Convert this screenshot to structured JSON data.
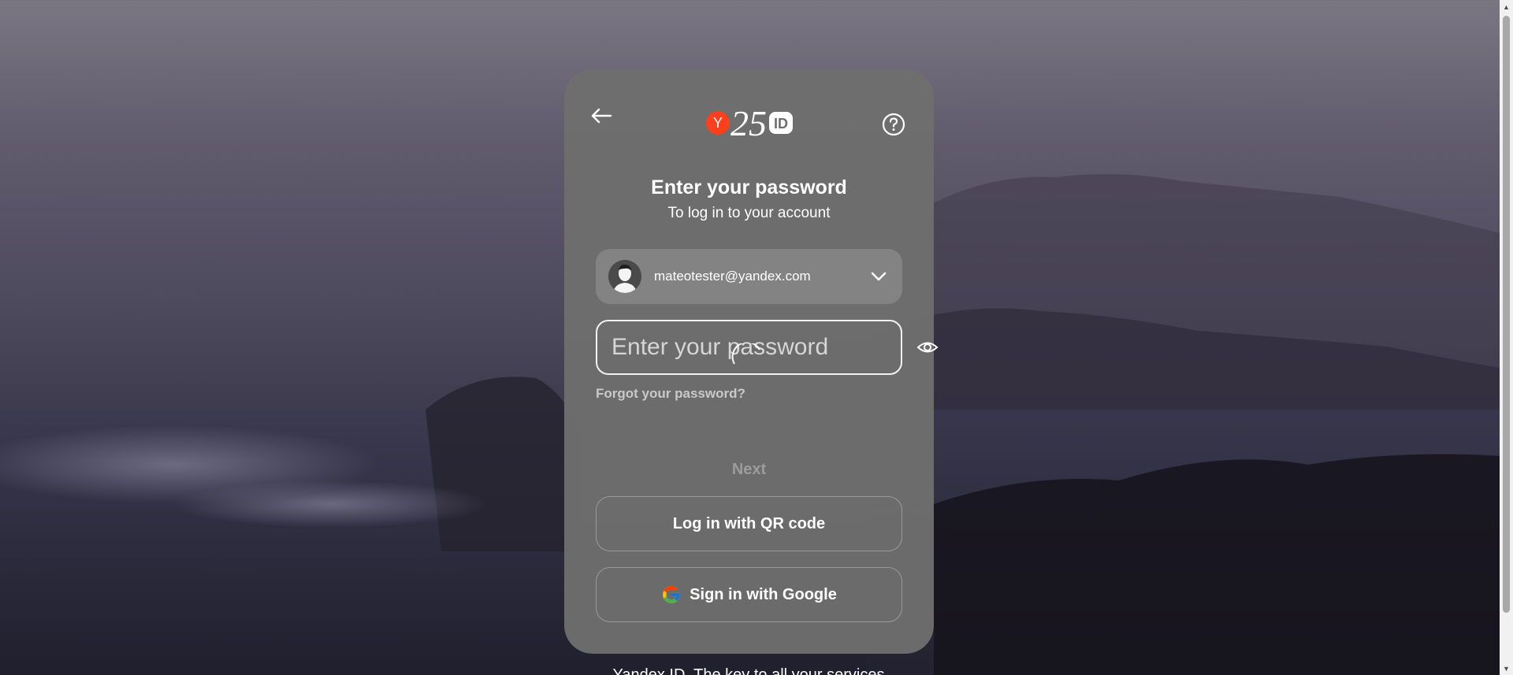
{
  "page": {
    "title": "Enter your password",
    "subtitle": "To log in to your account"
  },
  "header": {
    "logo_text": "25",
    "logo_letter": "Y",
    "logo_id": "ID"
  },
  "account": {
    "email": "mateotester@yandex.com"
  },
  "password_field": {
    "placeholder": "Enter your password",
    "value": ""
  },
  "links": {
    "forgot": "Forgot your password?"
  },
  "buttons": {
    "next": "Next",
    "qr": "Log in with QR code",
    "google": "Sign in with Google"
  },
  "footer": {
    "text": "Yandex ID. The key to all your services"
  },
  "icons": {
    "back": "arrow-left-icon",
    "help": "question-circle-icon",
    "chevron": "chevron-down-icon",
    "eye": "eye-icon",
    "google": "google-icon",
    "avatar": "user-avatar-icon",
    "loading": "spinner-icon"
  },
  "colors": {
    "brand_red": "#fc3f1d",
    "card_bg": "#6e6e6e"
  }
}
